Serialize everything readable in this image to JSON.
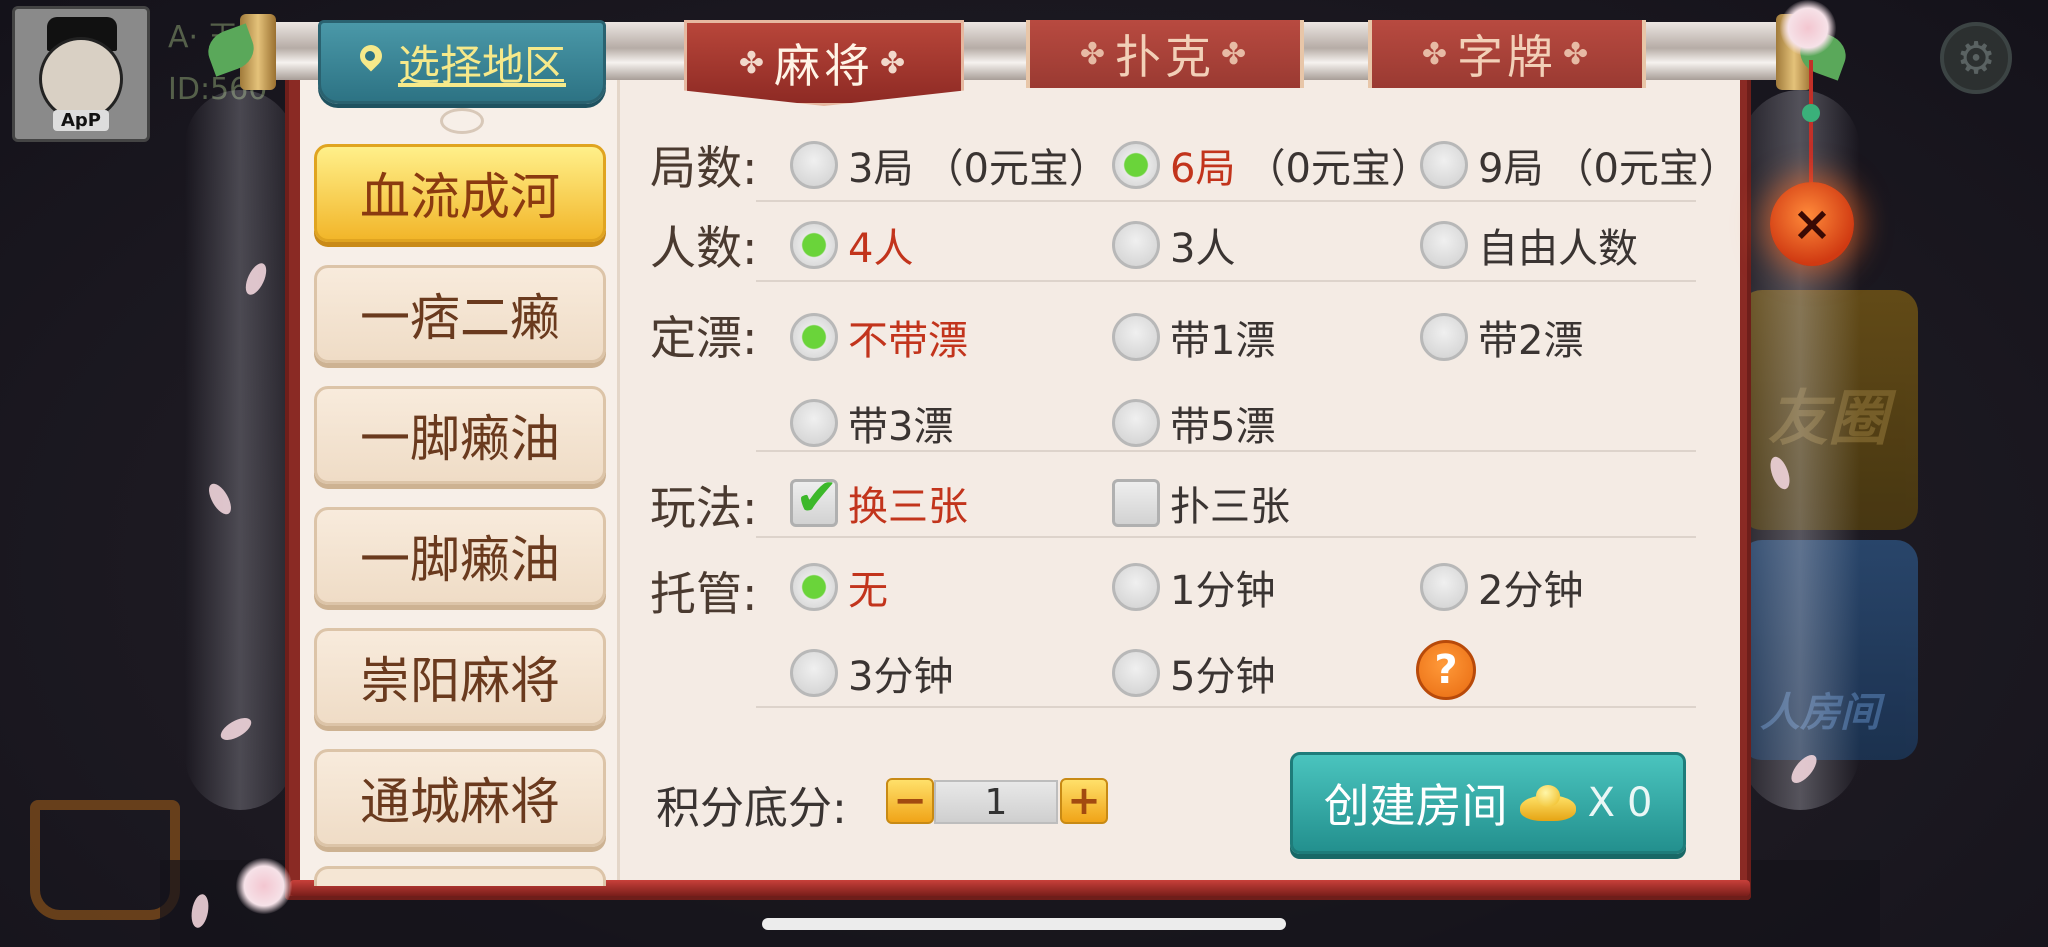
{
  "background": {
    "player_name": "A· 王",
    "player_id": "ID:560",
    "avatar_label": "ApP",
    "card_friend_circle": "友圈",
    "card_room": "人房间"
  },
  "region_button": {
    "label": "选择地区",
    "icon": "location-pin-icon"
  },
  "tabs": [
    {
      "label": "麻将",
      "active": true
    },
    {
      "label": "扑克",
      "active": false
    },
    {
      "label": "字牌",
      "active": false
    }
  ],
  "games": [
    {
      "label": "血流成河",
      "active": true
    },
    {
      "label": "一痞二癞",
      "active": false
    },
    {
      "label": "一脚癞油",
      "active": false
    },
    {
      "label": "一脚癞油",
      "active": false
    },
    {
      "label": "崇阳麻将",
      "active": false
    },
    {
      "label": "通城麻将",
      "active": false
    }
  ],
  "settings": {
    "rounds": {
      "label": "局数:",
      "options": [
        {
          "text": "3局",
          "suffix": "（0元宝）",
          "selected": false
        },
        {
          "text": "6局",
          "suffix": "（0元宝）",
          "selected": true
        },
        {
          "text": "9局",
          "suffix": "（0元宝）",
          "selected": false
        }
      ]
    },
    "players": {
      "label": "人数:",
      "options": [
        {
          "text": "4人",
          "selected": true
        },
        {
          "text": "3人",
          "selected": false
        },
        {
          "text": "自由人数",
          "selected": false
        }
      ]
    },
    "piao": {
      "label": "定漂:",
      "options": [
        {
          "text": "不带漂",
          "selected": true
        },
        {
          "text": "带1漂",
          "selected": false
        },
        {
          "text": "带2漂",
          "selected": false
        },
        {
          "text": "带3漂",
          "selected": false
        },
        {
          "text": "带5漂",
          "selected": false
        }
      ]
    },
    "rules": {
      "label": "玩法:",
      "options": [
        {
          "text": "换三张",
          "checked": true
        },
        {
          "text": "扑三张",
          "checked": false
        }
      ]
    },
    "trustee": {
      "label": "托管:",
      "options": [
        {
          "text": "无",
          "selected": true
        },
        {
          "text": "1分钟",
          "selected": false
        },
        {
          "text": "2分钟",
          "selected": false
        },
        {
          "text": "3分钟",
          "selected": false
        },
        {
          "text": "5分钟",
          "selected": false
        }
      ],
      "help_icon": "?"
    }
  },
  "score": {
    "label": "积分底分:",
    "value": "1",
    "minus": "−",
    "plus": "+"
  },
  "create_room": {
    "label": "创建房间",
    "times": "X",
    "cost": "0",
    "icon": "gold-ingot-icon"
  },
  "close_icon": "×",
  "colors": {
    "selected_text": "#c2341c",
    "accent_teal": "#2d7384",
    "gold": "#f2b62a"
  }
}
